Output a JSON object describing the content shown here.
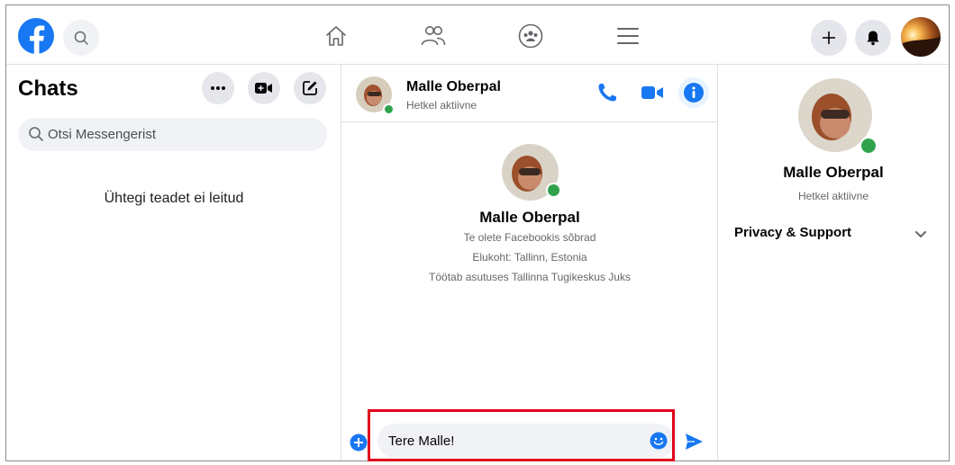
{
  "nav": {
    "search_label": "Search Facebook",
    "avatar": "profile photo"
  },
  "left": {
    "title": "Chats",
    "search_placeholder": "Otsi Messengerist",
    "empty_text": "Ühtegi teadet ei leitud"
  },
  "conversation": {
    "name": "Malle Oberpal",
    "status": "Hetkel aktiivne",
    "profile": {
      "name": "Malle Oberpal",
      "friends": "Te olete Facebookis sõbrad",
      "location": "Elukoht: Tallinn, Estonia",
      "work": "Töötab asutuses Tallinna Tugikeskus Juks"
    },
    "composer_value": "Tere Malle!"
  },
  "info_panel": {
    "name": "Malle Oberpal",
    "status": "Hetkel aktiivne",
    "section": "Privacy & Support"
  },
  "colors": {
    "brand": "#1877f2",
    "online": "#31a24c",
    "highlight": "#e0001b"
  }
}
